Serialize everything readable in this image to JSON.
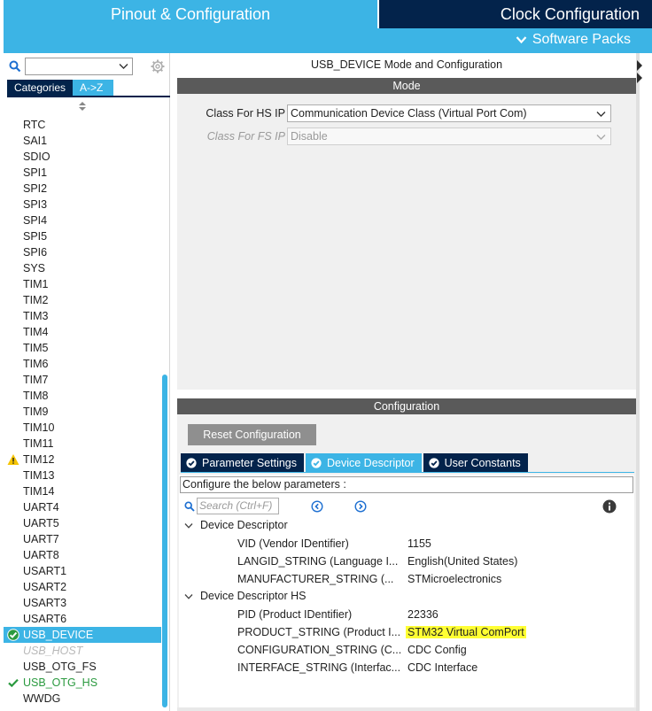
{
  "top_tabs": {
    "pinout": "Pinout & Configuration",
    "clock": "Clock Configuration",
    "software_packs": "Software Packs"
  },
  "left_panel": {
    "search_value": "",
    "tabs": {
      "categories": "Categories",
      "az": "A->Z"
    },
    "items": [
      {
        "label": "RTC",
        "state": "normal"
      },
      {
        "label": "SAI1",
        "state": "normal"
      },
      {
        "label": "SDIO",
        "state": "normal"
      },
      {
        "label": "SPI1",
        "state": "normal"
      },
      {
        "label": "SPI2",
        "state": "normal"
      },
      {
        "label": "SPI3",
        "state": "normal"
      },
      {
        "label": "SPI4",
        "state": "normal"
      },
      {
        "label": "SPI5",
        "state": "normal"
      },
      {
        "label": "SPI6",
        "state": "normal"
      },
      {
        "label": "SYS",
        "state": "normal"
      },
      {
        "label": "TIM1",
        "state": "normal"
      },
      {
        "label": "TIM2",
        "state": "normal"
      },
      {
        "label": "TIM3",
        "state": "normal"
      },
      {
        "label": "TIM4",
        "state": "normal"
      },
      {
        "label": "TIM5",
        "state": "normal"
      },
      {
        "label": "TIM6",
        "state": "normal"
      },
      {
        "label": "TIM7",
        "state": "normal"
      },
      {
        "label": "TIM8",
        "state": "normal"
      },
      {
        "label": "TIM9",
        "state": "normal"
      },
      {
        "label": "TIM10",
        "state": "normal"
      },
      {
        "label": "TIM11",
        "state": "normal"
      },
      {
        "label": "TIM12",
        "state": "warning",
        "icon": "warning-icon"
      },
      {
        "label": "TIM13",
        "state": "normal"
      },
      {
        "label": "TIM14",
        "state": "normal"
      },
      {
        "label": "UART4",
        "state": "normal"
      },
      {
        "label": "UART5",
        "state": "normal"
      },
      {
        "label": "UART7",
        "state": "normal"
      },
      {
        "label": "UART8",
        "state": "normal"
      },
      {
        "label": "USART1",
        "state": "normal"
      },
      {
        "label": "USART2",
        "state": "normal"
      },
      {
        "label": "USART3",
        "state": "normal"
      },
      {
        "label": "USART6",
        "state": "normal"
      },
      {
        "label": "USB_DEVICE",
        "state": "selected",
        "icon": "check-circle-icon"
      },
      {
        "label": "USB_HOST",
        "state": "disabled"
      },
      {
        "label": "USB_OTG_FS",
        "state": "normal"
      },
      {
        "label": "USB_OTG_HS",
        "state": "green",
        "icon": "check-icon"
      },
      {
        "label": "WWDG",
        "state": "normal"
      }
    ]
  },
  "mode_panel": {
    "title": "USB_DEVICE Mode and Configuration",
    "section_label": "Mode",
    "class_hs": {
      "label": "Class For HS IP",
      "value": "Communication Device Class (Virtual Port Com)"
    },
    "class_fs": {
      "label": "Class For FS IP",
      "value": "Disable"
    }
  },
  "config_panel": {
    "section_label": "Configuration",
    "reset_button": "Reset Configuration",
    "tabs": [
      {
        "label": "Parameter Settings",
        "active": false
      },
      {
        "label": "Device Descriptor",
        "active": true
      },
      {
        "label": "User Constants",
        "active": false
      }
    ],
    "instruction": "Configure the below parameters :",
    "search_placeholder": "Search (Ctrl+F)",
    "groups": [
      {
        "label": "Device Descriptor",
        "params": [
          {
            "name": "VID (Vendor IDentifier)",
            "value": "1155"
          },
          {
            "name": "LANGID_STRING (Language I...",
            "value": "English(United States)"
          },
          {
            "name": "MANUFACTURER_STRING (...",
            "value": "STMicroelectronics"
          }
        ]
      },
      {
        "label": "Device Descriptor HS",
        "params": [
          {
            "name": "PID (Product IDentifier)",
            "value": "22336"
          },
          {
            "name": "PRODUCT_STRING (Product I...",
            "value": "STM32 Virtual ComPort",
            "highlight": true
          },
          {
            "name": "CONFIGURATION_STRING (C...",
            "value": "CDC Config"
          },
          {
            "name": "INTERFACE_STRING (Interfac...",
            "value": "CDC Interface"
          }
        ]
      }
    ]
  },
  "colors": {
    "accent_blue": "#3cb4e5",
    "navy": "#03234b",
    "section_gray": "#5a5a5a",
    "highlight_yellow": "#ffff33",
    "ok_green": "#2a9a3f",
    "warning_yellow": "#f5c400"
  }
}
